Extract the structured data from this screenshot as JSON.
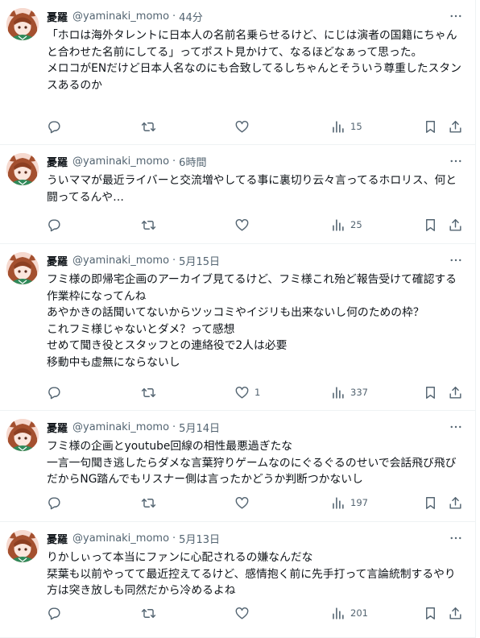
{
  "tweets": [
    {
      "name": "憂羅",
      "handle": "@yaminaki_momo",
      "sep": "·",
      "time": "44分",
      "text": "「ホロは海外タレントに日本人の名前名乗らせるけど、にじは演者の国籍にちゃんと合わせた名前にしてる」ってポスト見かけて、なるほどなぁって思った。\nメロコがENだけど日本人名なのにも合致してるしちゃんとそういう尊重したスタンスあるのか",
      "likes": "",
      "views": "15"
    },
    {
      "name": "憂羅",
      "handle": "@yaminaki_momo",
      "sep": "·",
      "time": "6時間",
      "text": "ういママが最近ライバーと交流増やしてる事に裏切り云々言ってるホロリス、何と闘ってるんや…",
      "likes": "",
      "views": "25"
    },
    {
      "name": "憂羅",
      "handle": "@yaminaki_momo",
      "sep": "·",
      "time": "5月15日",
      "text": "フミ様の即帰宅企画のアーカイブ見てるけど、フミ様これ殆ど報告受けて確認する作業枠になってんね\nあやかきの話聞いてないからツッコミやイジリも出来ないし何のための枠？\nこれフミ様じゃないとダメ？って感想\nせめて聞き役とスタッフとの連絡役で2人は必要\n移動中も虚無にならないし",
      "likes": "1",
      "views": "337"
    },
    {
      "name": "憂羅",
      "handle": "@yaminaki_momo",
      "sep": "·",
      "time": "5月14日",
      "text": "フミ様の企画とyoutube回線の相性最悪過ぎたな\n一言一句聞き逃したらダメな言葉狩りゲームなのにぐるぐるのせいで会話飛び飛びだからNG踏んでもリスナー側は言ったかどうか判断つかないし",
      "likes": "",
      "views": "197"
    },
    {
      "name": "憂羅",
      "handle": "@yaminaki_momo",
      "sep": "·",
      "time": "5月13日",
      "text": "りかしぃって本当にファンに心配されるの嫌なんだな\n栞葉も以前やってて最近控えてるけど、感情抱く前に先手打って言論統制するやり方は突き放しも同然だから冷めるよね",
      "likes": "",
      "views": "201"
    }
  ],
  "icons": {
    "more": "more-horizontal-icon",
    "reply": "reply-icon",
    "retweet": "retweet-icon",
    "like": "heart-icon",
    "views": "analytics-icon",
    "bookmark": "bookmark-icon",
    "share": "share-icon"
  },
  "colors": {
    "text": "#0f1419",
    "secondary": "#536471",
    "border": "#eff3f4"
  }
}
